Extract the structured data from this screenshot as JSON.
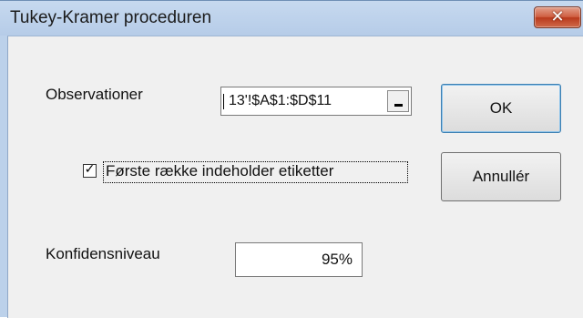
{
  "window": {
    "title": "Tukey-Kramer proceduren",
    "close_glyph": "✕"
  },
  "form": {
    "observations_label": "Observationer",
    "observations_value": "13'!$A$1:$D$11",
    "collapse_glyph": "_",
    "first_row_label": "Første række indeholder etiketter",
    "first_row_checked": true,
    "checkmark_glyph": "✓",
    "confidence_label": "Konfidensniveau",
    "confidence_value": "95%"
  },
  "buttons": {
    "ok_label": "OK",
    "cancel_label": "Annullér"
  },
  "colors": {
    "titlebar": "#bcd1ea",
    "client": "#f0f0f0",
    "close": "#c94f33",
    "default_button_border": "#3c7fb1"
  },
  "icons": [
    "close-icon",
    "collapse-dialog-icon",
    "checkmark-icon"
  ]
}
